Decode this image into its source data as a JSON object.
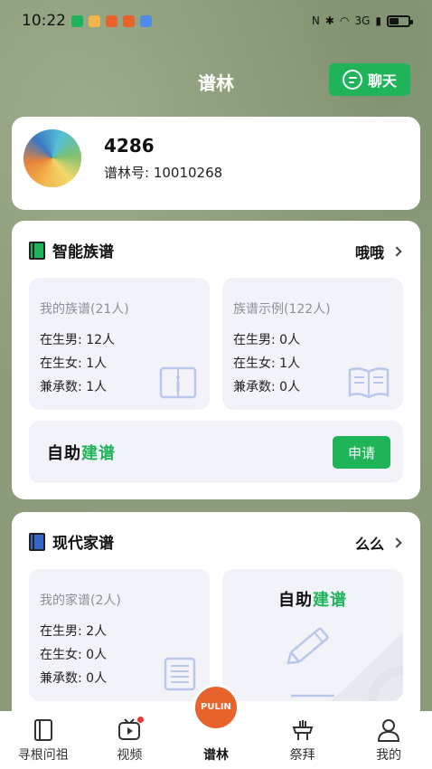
{
  "status_bar": {
    "time": "10:22",
    "notification_colors": [
      "#1fb35a",
      "#f2b54b",
      "#e8622c",
      "#e8622c",
      "#4f8ce8"
    ],
    "signal_text": "3G"
  },
  "header": {
    "title": "谱林",
    "chat_label": "聊天"
  },
  "profile": {
    "name": "4286",
    "id_text": "谱林号: 10010268"
  },
  "family_section": {
    "title": "智能族谱",
    "link_label": "哦哦",
    "my_tree": {
      "title": "我的族谱(21人)",
      "male": "在生男: 12人",
      "female": "在生女: 1人",
      "heirs": "兼承数: 1人"
    },
    "example_tree": {
      "title": "族谱示例(122人)",
      "male": "在生男: 0人",
      "female": "在生女: 1人",
      "heirs": "兼承数: 0人"
    },
    "self_build_black": "自助",
    "self_build_green": "建谱",
    "apply_label": "申请"
  },
  "modern_section": {
    "title": "现代家谱",
    "link_label": "么么",
    "my_tree": {
      "title": "我的家谱(2人)",
      "male": "在生男: 2人",
      "female": "在生女: 0人",
      "heirs": "兼承数: 0人"
    },
    "self_build_black": "自助",
    "self_build_green": "建谱"
  },
  "bottom_nav": {
    "items": [
      {
        "label": "寻根问祖"
      },
      {
        "label": "视频"
      },
      {
        "label": "谱林"
      },
      {
        "label": "祭拜"
      },
      {
        "label": "我的"
      }
    ],
    "center_logo_text": "PULIN"
  },
  "colors": {
    "accent": "#1fb35a",
    "nav_center": "#e8622c"
  }
}
